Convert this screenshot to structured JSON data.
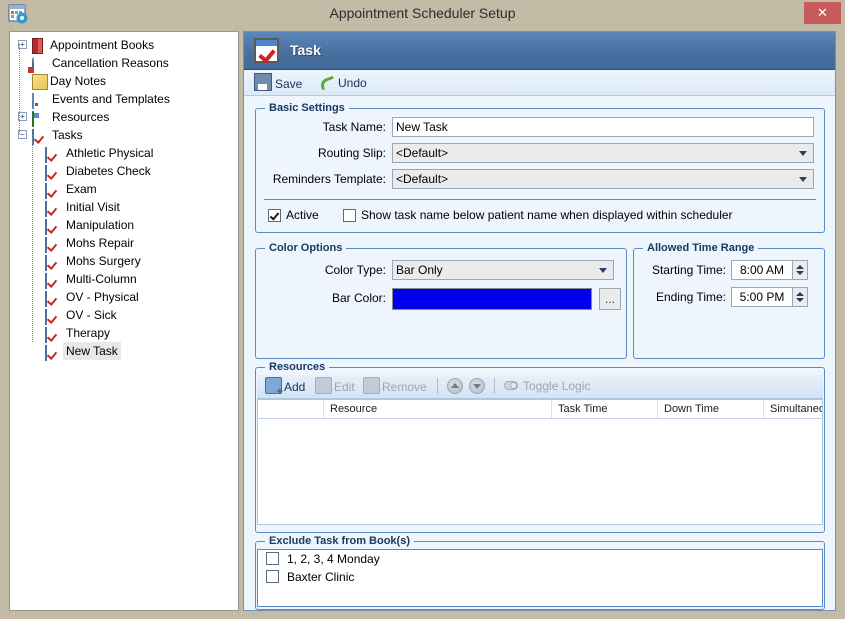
{
  "window": {
    "title": "Appointment Scheduler Setup",
    "icon": "calendar-settings-icon",
    "close_label": "✕"
  },
  "tree": {
    "nodes": [
      {
        "label": "Appointment Books",
        "icon": "book-icon",
        "expander": "+",
        "level": 0,
        "selected": false
      },
      {
        "label": "Cancellation Reasons",
        "icon": "clock-icon",
        "expander": "",
        "level": 0,
        "selected": false
      },
      {
        "label": "Day Notes",
        "icon": "note-icon",
        "expander": "",
        "level": 0,
        "selected": false
      },
      {
        "label": "Events and Templates",
        "icon": "calendar-icon",
        "expander": "",
        "level": 0,
        "selected": false
      },
      {
        "label": "Resources",
        "icon": "puzzle-icon",
        "expander": "+",
        "level": 0,
        "selected": false
      },
      {
        "label": "Tasks",
        "icon": "task-icon",
        "expander": "−",
        "level": 0,
        "selected": false
      },
      {
        "label": "Athletic Physical",
        "icon": "task-icon",
        "expander": "",
        "level": 1,
        "selected": false
      },
      {
        "label": "Diabetes Check",
        "icon": "task-icon",
        "expander": "",
        "level": 1,
        "selected": false
      },
      {
        "label": "Exam",
        "icon": "task-icon",
        "expander": "",
        "level": 1,
        "selected": false
      },
      {
        "label": "Initial Visit",
        "icon": "task-icon",
        "expander": "",
        "level": 1,
        "selected": false
      },
      {
        "label": "Manipulation",
        "icon": "task-icon",
        "expander": "",
        "level": 1,
        "selected": false
      },
      {
        "label": "Mohs Repair",
        "icon": "task-icon",
        "expander": "",
        "level": 1,
        "selected": false
      },
      {
        "label": "Mohs Surgery",
        "icon": "task-icon",
        "expander": "",
        "level": 1,
        "selected": false
      },
      {
        "label": "Multi-Column",
        "icon": "task-icon",
        "expander": "",
        "level": 1,
        "selected": false
      },
      {
        "label": "OV - Physical",
        "icon": "task-icon",
        "expander": "",
        "level": 1,
        "selected": false
      },
      {
        "label": "OV - Sick",
        "icon": "task-icon",
        "expander": "",
        "level": 1,
        "selected": false
      },
      {
        "label": "Therapy",
        "icon": "task-icon",
        "expander": "",
        "level": 1,
        "selected": false
      },
      {
        "label": "New Task",
        "icon": "task-icon",
        "expander": "",
        "level": 1,
        "selected": true
      }
    ]
  },
  "panel": {
    "header_title": "Task",
    "header_icon": "task-icon",
    "toolbar": {
      "save_label": "Save",
      "undo_label": "Undo"
    }
  },
  "basic_settings": {
    "title": "Basic Settings",
    "task_name_label": "Task Name:",
    "task_name_value": "New Task",
    "routing_slip_label": "Routing Slip:",
    "routing_slip_value": "<Default>",
    "reminders_template_label": "Reminders Template:",
    "reminders_template_value": "<Default>",
    "active_label": "Active",
    "active_checked": true,
    "show_task_name_label": "Show task name below patient name when displayed within scheduler",
    "show_task_name_checked": false
  },
  "color_options": {
    "title": "Color Options",
    "color_type_label": "Color Type:",
    "color_type_value": "Bar Only",
    "bar_color_label": "Bar Color:",
    "bar_color_value": "#0000ee",
    "browse_label": "..."
  },
  "allowed_time_range": {
    "title": "Allowed Time Range",
    "starting_time_label": "Starting Time:",
    "starting_time_value": "8:00 AM",
    "ending_time_label": "Ending Time:",
    "ending_time_value": "5:00 PM"
  },
  "resources": {
    "title": "Resources",
    "toolbar": {
      "add_label": "Add",
      "edit_label": "Edit",
      "remove_label": "Remove",
      "toggle_logic_label": "Toggle Logic",
      "move_up_icon": "arrow-up-icon",
      "move_down_icon": "arrow-down-icon"
    },
    "columns": [
      "Resource",
      "Task Time",
      "Down Time",
      "Simultaneous"
    ],
    "rows": []
  },
  "exclude_books": {
    "title": "Exclude Task from Book(s)",
    "items": [
      {
        "label": "1, 2, 3, 4 Monday",
        "checked": false
      },
      {
        "label": "Baxter Clinic",
        "checked": false
      }
    ]
  }
}
